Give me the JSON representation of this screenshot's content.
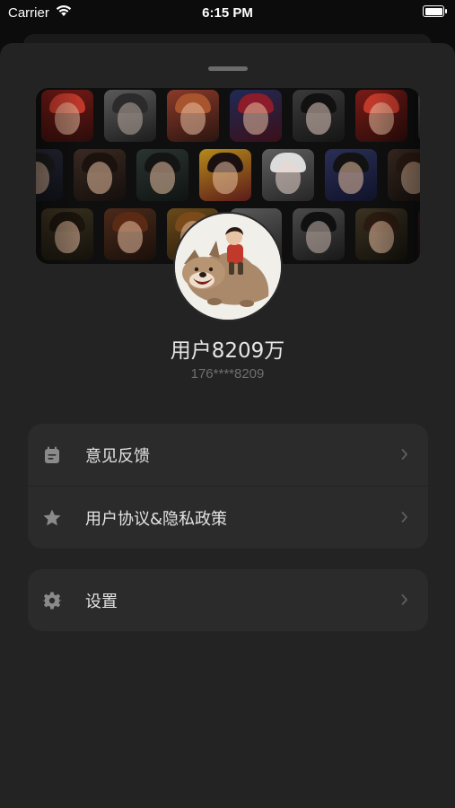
{
  "status_bar": {
    "carrier": "Carrier",
    "time": "6:15 PM",
    "wifi_icon": "wifi-icon",
    "battery_icon": "battery-icon"
  },
  "profile": {
    "banner": "portrait-collage",
    "avatar": "wolf-rider-avatar",
    "name": "用户8209万",
    "phone": "176****8209"
  },
  "menu": {
    "group1": [
      {
        "id": "feedback",
        "icon": "feedback-icon",
        "label": "意见反馈"
      },
      {
        "id": "agreement",
        "icon": "star-icon",
        "label": "用户协议&隐私政策"
      }
    ],
    "group2": [
      {
        "id": "settings",
        "icon": "gear-icon",
        "label": "设置"
      }
    ]
  },
  "colors": {
    "background": "#0c0c0c",
    "sheet": "#232323",
    "card": "#2b2b2b",
    "text": "#e3e3e3",
    "muted": "#6e6e6e",
    "icon": "#8a8a8a"
  }
}
